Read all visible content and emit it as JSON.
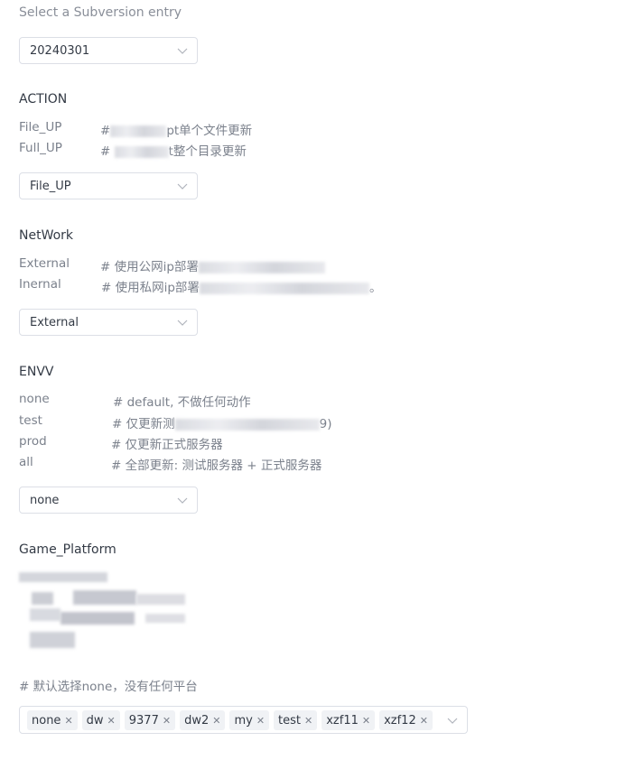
{
  "subversion": {
    "label": "Select a Subversion entry",
    "selected": "20240301"
  },
  "action": {
    "title": "ACTION",
    "options": [
      {
        "key": "File_UP",
        "desc_prefix": "#",
        "desc_suffix": "pt单个文件更新"
      },
      {
        "key": "Full_UP",
        "desc_prefix": "#",
        "desc_suffix": "t整个目录更新"
      }
    ],
    "selected": "File_UP"
  },
  "network": {
    "title": "NetWork",
    "options": [
      {
        "key": "External",
        "desc_prefix": "# 使用公网ip部署",
        "desc_suffix": ""
      },
      {
        "key": "Inernal",
        "desc_prefix": "# 使用私网ip部署",
        "desc_suffix": "。"
      }
    ],
    "selected": "External"
  },
  "envv": {
    "title": "ENVV",
    "options": [
      {
        "key": "none",
        "desc_prefix": "# default, 不做任何动作",
        "desc_suffix": ""
      },
      {
        "key": "test",
        "desc_prefix": "# 仅更新测",
        "desc_suffix": "9)"
      },
      {
        "key": "prod",
        "desc_prefix": "# 仅更新正式服务器",
        "desc_suffix": ""
      },
      {
        "key": "all",
        "desc_prefix": "# 全部更新: 测试服务器 + 正式服务器",
        "desc_suffix": ""
      }
    ],
    "selected": "none"
  },
  "game_platform": {
    "title": "Game_Platform",
    "note": "# 默认选择none，没有任何平台",
    "selected_tags": [
      "none",
      "dw",
      "9377",
      "dw2",
      "my",
      "test",
      "xzf11",
      "xzf12"
    ]
  },
  "icons": {
    "chevron": "chevron-down-icon",
    "remove": "close-icon"
  },
  "colors": {
    "border": "#dcdfe6",
    "tag_bg": "#f0f2f5",
    "muted": "#7b818c"
  }
}
